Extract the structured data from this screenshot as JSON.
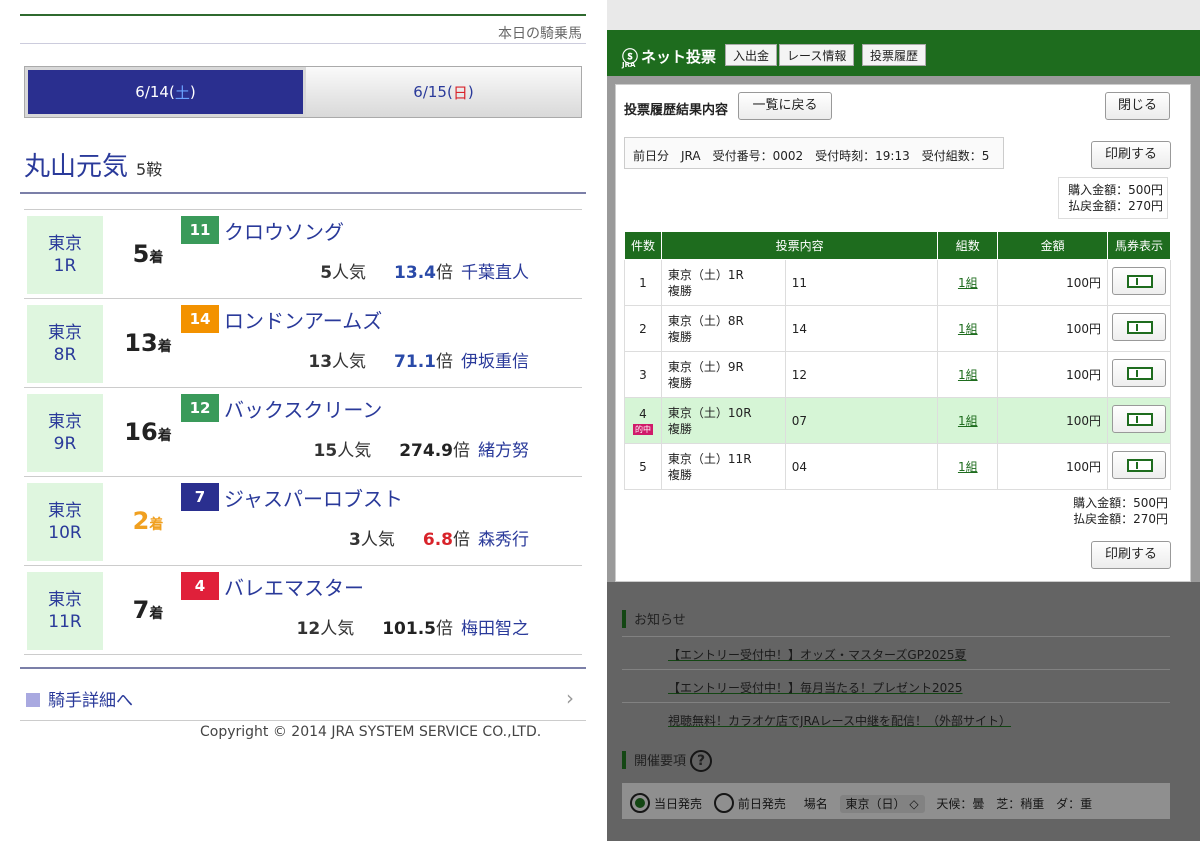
{
  "left": {
    "top_label": "本日の騎乗馬",
    "tabs": [
      {
        "date": "6/14(",
        "dow": "土",
        "close": ")",
        "active": true
      },
      {
        "date": "6/15(",
        "dow": "日",
        "close": ")",
        "active": false
      }
    ],
    "jockey": {
      "name": "丸山元気",
      "rides": "5鞍"
    },
    "rides": [
      {
        "venue": "東京",
        "race": "1R",
        "place": "5",
        "place_unit": "着",
        "num": "11",
        "num_color": "#3a9a5a",
        "horse": "クロウソング",
        "pop": "5",
        "pop_unit": "人気",
        "odds": "13.4",
        "odds_unit": "倍",
        "odds_color": "#2a4aa8",
        "jockey": "千葉直人"
      },
      {
        "venue": "東京",
        "race": "8R",
        "place": "13",
        "place_unit": "着",
        "num": "14",
        "num_color": "#f39200",
        "horse": "ロンドンアームズ",
        "pop": "13",
        "pop_unit": "人気",
        "odds": "71.1",
        "odds_unit": "倍",
        "odds_color": "#2a4aa8",
        "jockey": "伊坂重信"
      },
      {
        "venue": "東京",
        "race": "9R",
        "place": "16",
        "place_unit": "着",
        "num": "12",
        "num_color": "#3a9a5a",
        "horse": "バックスクリーン",
        "pop": "15",
        "pop_unit": "人気",
        "odds": "274.9",
        "odds_unit": "倍",
        "odds_color": "#222222",
        "jockey": "緒方努"
      },
      {
        "venue": "東京",
        "race": "10R",
        "place": "2",
        "place_unit": "着",
        "num": "7",
        "num_color": "#2a2f8f",
        "horse": "ジャスパーロブスト",
        "pop": "3",
        "pop_unit": "人気",
        "odds": "6.8",
        "odds_unit": "倍",
        "odds_color": "#d8232a",
        "jockey": "森秀行"
      },
      {
        "venue": "東京",
        "race": "11R",
        "place": "7",
        "place_unit": "着",
        "num": "4",
        "num_color": "#e0203a",
        "horse": "バレエマスター",
        "pop": "12",
        "pop_unit": "人気",
        "odds": "101.5",
        "odds_unit": "倍",
        "odds_color": "#222222",
        "jockey": "梅田智之"
      }
    ],
    "detail_link": "騎手詳細へ",
    "copyright": "Copyright © 2014 JRA SYSTEM SERVICE CO.,LTD."
  },
  "right": {
    "logo": "ネット投票",
    "logo_sub": "JRA",
    "nav": [
      "入出金",
      "レース情報",
      "投票履歴"
    ],
    "title": "投票履歴結果内容",
    "back_button": "一覧に戻る",
    "close_button": "閉じる",
    "receipt": "前日分　JRA　受付番号：0002　受付時刻：19:13　受付組数：5",
    "print_button": "印刷する",
    "purchase": "購入金額：500円",
    "refund": "払戻金額：270円",
    "table": {
      "headers": [
        "件数",
        "投票内容",
        "組数",
        "金額",
        "馬券表示"
      ],
      "rows": [
        {
          "no": "1",
          "race": "東京（土）1R",
          "type": "複勝",
          "horse": "11",
          "sets": "1組",
          "amount": "100円",
          "hit": false
        },
        {
          "no": "2",
          "race": "東京（土）8R",
          "type": "複勝",
          "horse": "14",
          "sets": "1組",
          "amount": "100円",
          "hit": false
        },
        {
          "no": "3",
          "race": "東京（土）9R",
          "type": "複勝",
          "horse": "12",
          "sets": "1組",
          "amount": "100円",
          "hit": false
        },
        {
          "no": "4",
          "race": "東京（土）10R",
          "type": "複勝",
          "horse": "07",
          "sets": "1組",
          "amount": "100円",
          "hit": true,
          "badge": "的中"
        },
        {
          "no": "5",
          "race": "東京（土）11R",
          "type": "複勝",
          "horse": "04",
          "sets": "1組",
          "amount": "100円",
          "hit": false
        }
      ]
    },
    "news_title": "お知らせ",
    "news": [
      "【エントリー受付中！】オッズ・マスターズGP2025夏",
      "【エントリー受付中！】毎月当たる！プレゼント2025",
      "視聴無料！カラオケ店でJRAレース中継を配信！（外部サイト）"
    ],
    "meeting_title": "開催要項",
    "help": "?",
    "options": {
      "today": "当日発売",
      "prev": "前日発売",
      "venue_label": "場名",
      "venue": "東京（日）",
      "weather": "天候：曇",
      "turf": "芝：稍重",
      "dirt": "ダ：重"
    }
  }
}
